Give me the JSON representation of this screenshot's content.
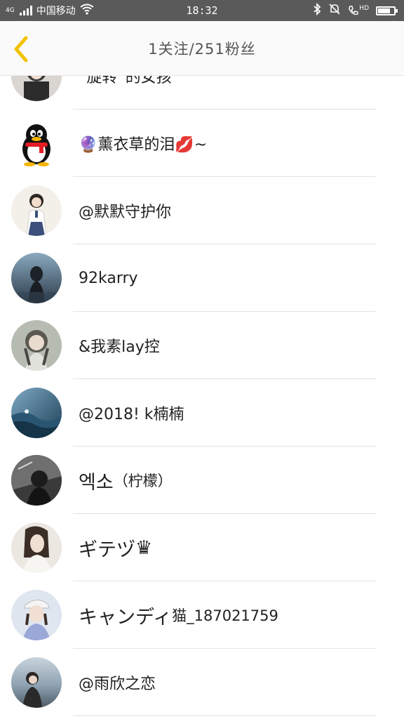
{
  "status_bar": {
    "network": "4G",
    "carrier": "中国移动",
    "time": "18:32",
    "hd_label": "HD",
    "battery_level": 0.75,
    "icons": [
      "signal-icon",
      "wifi-icon",
      "bluetooth-icon",
      "mute-icon",
      "hd-call-icon",
      "battery-icon"
    ]
  },
  "header": {
    "back_icon": "chevron-left-icon",
    "title": "1关注/251粉丝",
    "accent_color": "#f2c200"
  },
  "list": {
    "items": [
      {
        "name": "“旋转”的女孩",
        "avatar": "girl-photo"
      },
      {
        "name": "🔮薰衣草的泪💋~",
        "avatar": "qq-penguin"
      },
      {
        "name": "@默默守护你",
        "avatar": "girl-photo"
      },
      {
        "name": "92karry",
        "avatar": "tfboys-photo"
      },
      {
        "name": "&我素lay控",
        "avatar": "girl-photo"
      },
      {
        "name": "@2018! k楠楠",
        "avatar": "ocean-photo"
      },
      {
        "name_big": "엑소",
        "name_small": "（柠檬）",
        "avatar": "bw-photo"
      },
      {
        "name_big": "ギテヅ",
        "name_small": "♛",
        "avatar": "girl-photo"
      },
      {
        "name_big": "キャンディ",
        "name_small": "猫_187021759",
        "avatar": "girl-cap-photo"
      },
      {
        "name": "@雨欣之恋",
        "avatar": "girl-lake-photo"
      }
    ]
  }
}
